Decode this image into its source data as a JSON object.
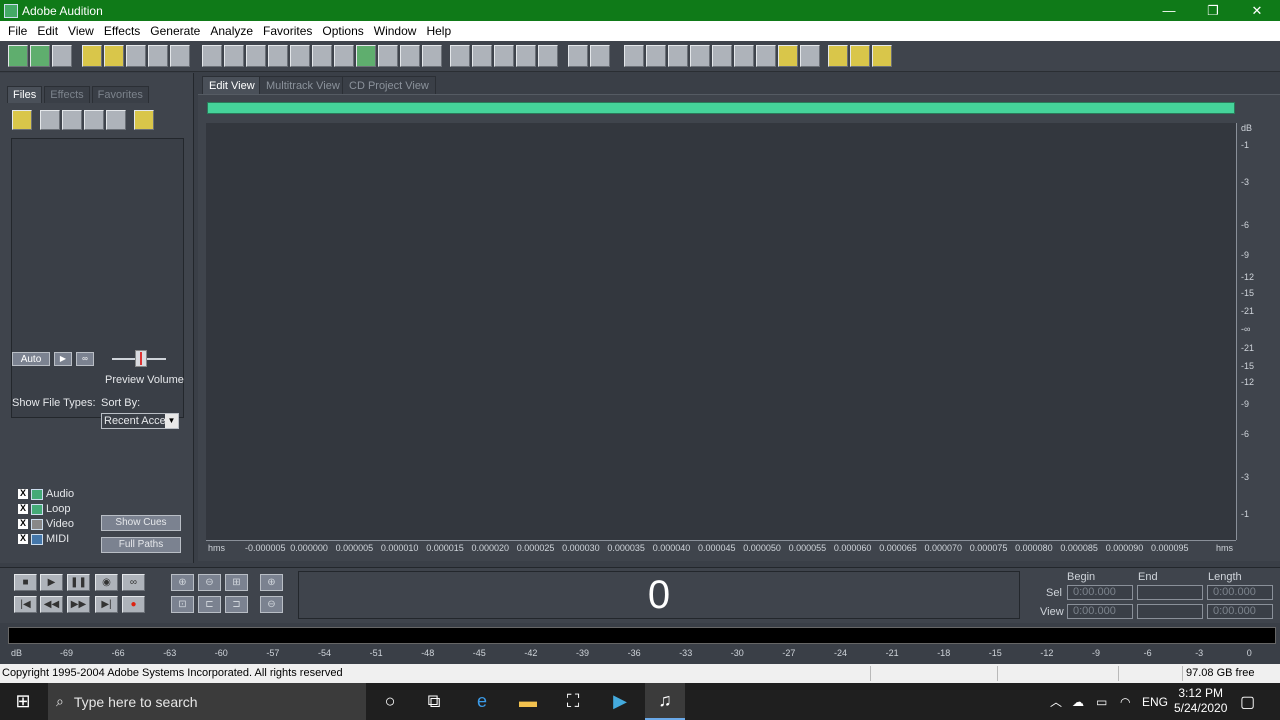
{
  "window": {
    "title": "Adobe Audition",
    "minimize": "—",
    "maximize": "❐",
    "close": "✕"
  },
  "menu": [
    "File",
    "Edit",
    "View",
    "Effects",
    "Generate",
    "Analyze",
    "Favorites",
    "Options",
    "Window",
    "Help"
  ],
  "panel": {
    "tabs": [
      "Files",
      "Effects",
      "Favorites"
    ],
    "auto_label": "Auto",
    "preview_volume_label": "Preview Volume",
    "show_file_types_label": "Show File Types:",
    "sort_by_label": "Sort By:",
    "file_types": [
      {
        "label": "Audio",
        "checked": true
      },
      {
        "label": "Loop",
        "checked": true
      },
      {
        "label": "Video",
        "checked": true
      },
      {
        "label": "MIDI",
        "checked": true
      }
    ],
    "sort_value": "Recent Access",
    "show_cues": "Show Cues",
    "full_paths": "Full Paths"
  },
  "views": {
    "tabs": [
      "Edit View",
      "Multitrack View",
      "CD Project View"
    ],
    "active": "Edit View"
  },
  "db_axis": {
    "unit": "dB",
    "ticks": [
      "-1",
      "-3",
      "-6",
      "-9",
      "-12",
      "-15",
      "-21",
      "-∞",
      "-21",
      "-15",
      "-12",
      "-9",
      "-6",
      "-3",
      "-1"
    ]
  },
  "time_axis": {
    "unit": "hms",
    "ticks": [
      "-0.000005",
      "0.000000",
      "0.000005",
      "0.000010",
      "0.000015",
      "0.000020",
      "0.000025",
      "0.000030",
      "0.000035",
      "0.000040",
      "0.000045",
      "0.000050",
      "0.000055",
      "0.000060",
      "0.000065",
      "0.000070",
      "0.000075",
      "0.000080",
      "0.000085",
      "0.000090",
      "0.000095"
    ]
  },
  "counter": "0",
  "selection": {
    "headers": [
      "Begin",
      "End",
      "Length"
    ],
    "sel_label": "Sel",
    "view_label": "View",
    "sel": {
      "begin": "0:00.000",
      "end": "",
      "length": "0:00.000"
    },
    "view": {
      "begin": "0:00.000",
      "end": "",
      "length": "0:00.000"
    }
  },
  "meter_ticks": [
    "dB",
    "-69",
    "-66",
    "-63",
    "-60",
    "-57",
    "-54",
    "-51",
    "-48",
    "-45",
    "-42",
    "-39",
    "-36",
    "-33",
    "-30",
    "-27",
    "-24",
    "-21",
    "-18",
    "-15",
    "-12",
    "-9",
    "-6",
    "-3",
    "0"
  ],
  "status": {
    "copyright": "Copyright 1995-2004 Adobe Systems Incorporated. All rights reserved",
    "free_space": "97.08 GB free"
  },
  "taskbar": {
    "search_placeholder": "Type here to search",
    "lang": "ENG",
    "time": "3:12 PM",
    "date": "5/24/2020"
  }
}
